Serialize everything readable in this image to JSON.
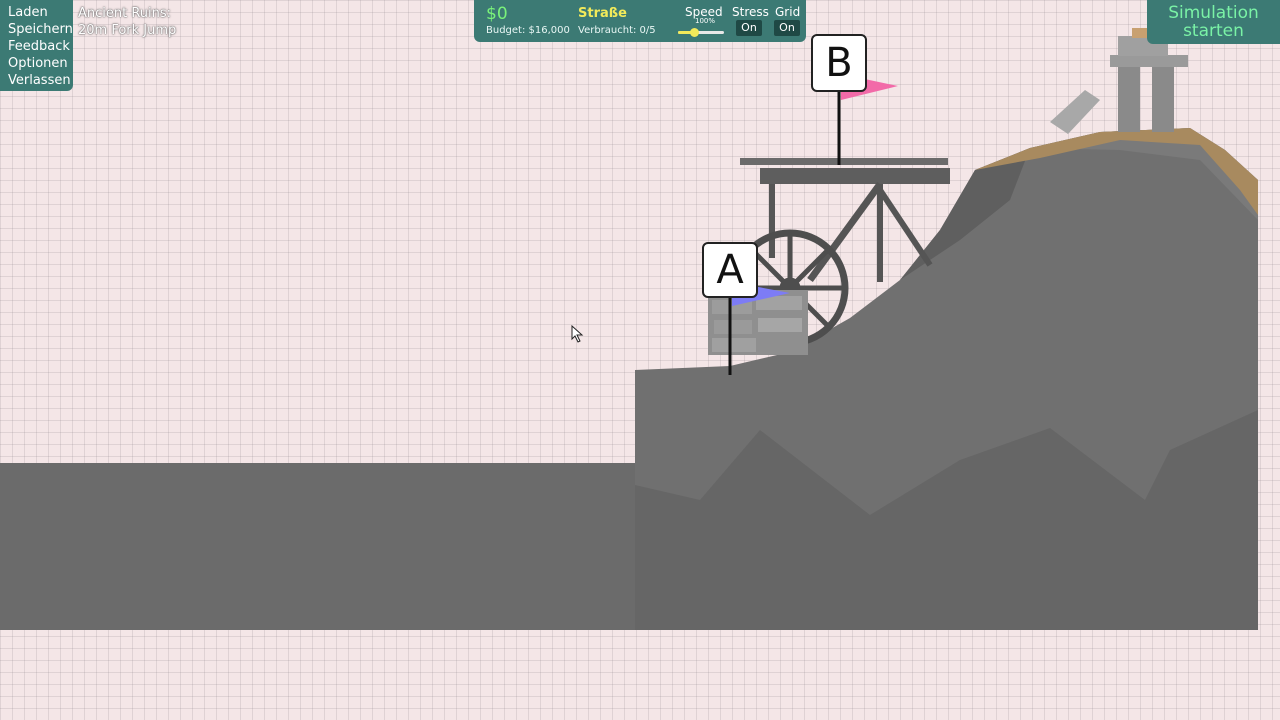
{
  "menu": {
    "items": [
      "Laden",
      "Speichern",
      "Feedback",
      "Optionen",
      "Verlassen"
    ]
  },
  "level": {
    "line1": "Ancient Ruins:",
    "line2": "20m Fork Jump"
  },
  "topbar": {
    "money": "$0",
    "budget": "Budget: $16,000",
    "material": "Straße",
    "used": "Verbraucht: 0/5",
    "speed_label": "Speed",
    "speed_pct": "100%",
    "speed_value": 0.35,
    "stress_label": "Stress",
    "stress_value": "On",
    "grid_label": "Grid",
    "grid_value": "On"
  },
  "sim": {
    "line1": "Simulation",
    "line2": "starten"
  },
  "flags": {
    "a": "A",
    "b": "B"
  },
  "colors": {
    "panel": "#3c7a74",
    "money": "#7af27a",
    "material": "#f2ea5a",
    "sim_text": "#7af2a6",
    "flag_a": "#7d7cf5",
    "flag_b": "#f26aa8",
    "ground": "#6b6b6b"
  }
}
